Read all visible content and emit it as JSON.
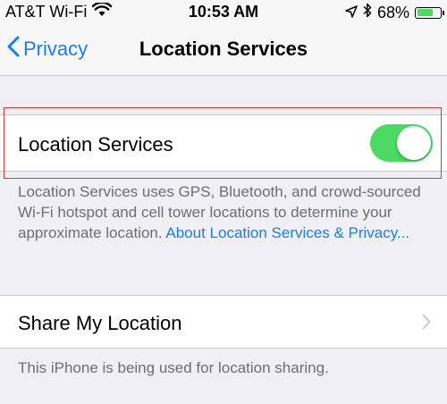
{
  "status_bar": {
    "carrier": "AT&T Wi-Fi",
    "time": "10:53 AM",
    "battery_percent": "68%",
    "battery_level": 0.68
  },
  "nav": {
    "back_label": "Privacy",
    "title": "Location Services"
  },
  "location_services": {
    "label": "Location Services",
    "enabled": true,
    "description": "Location Services uses GPS, Bluetooth, and crowd-sourced Wi-Fi hotspot and cell tower locations to determine your approximate location.",
    "link_text": "About Location Services & Privacy..."
  },
  "share_location": {
    "label": "Share My Location",
    "footer": "This iPhone is being used for location sharing."
  },
  "colors": {
    "accent": "#1a7cf1",
    "toggle_on": "#4cd964",
    "highlight": "#e4362e"
  },
  "icons": [
    "wifi-icon",
    "location-arrow-icon",
    "bluetooth-icon",
    "battery-icon",
    "chevron-left-icon",
    "chevron-right-icon"
  ]
}
